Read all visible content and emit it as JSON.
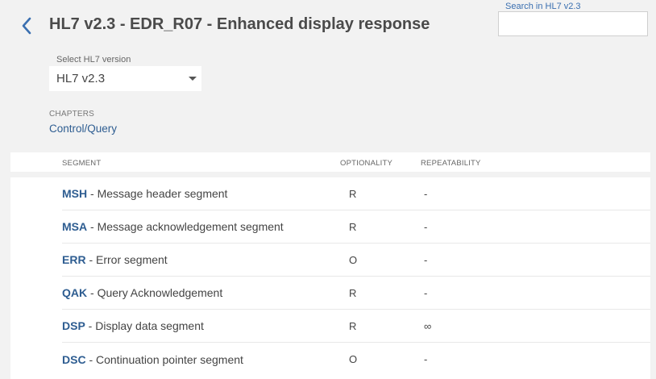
{
  "header": {
    "back_icon": "chevron-left-icon",
    "title": "HL7 v2.3 - EDR_R07 - Enhanced display response"
  },
  "search": {
    "label": "Search in HL7 v2.3",
    "value": ""
  },
  "version": {
    "label": "Select HL7 version",
    "selected": "HL7 v2.3"
  },
  "chapters": {
    "label": "CHAPTERS",
    "link": "Control/Query"
  },
  "table": {
    "columns": [
      "SEGMENT",
      "OPTIONALITY",
      "REPEATABILITY"
    ],
    "rows": [
      {
        "code": "MSH",
        "desc": " - Message header segment",
        "opt": "R",
        "rep": "-"
      },
      {
        "code": "MSA",
        "desc": " - Message acknowledgement segment",
        "opt": "R",
        "rep": "-"
      },
      {
        "code": "ERR",
        "desc": " - Error segment",
        "opt": "O",
        "rep": "-"
      },
      {
        "code": "QAK",
        "desc": " - Query Acknowledgement",
        "opt": "R",
        "rep": "-"
      },
      {
        "code": "DSP",
        "desc": " - Display data segment",
        "opt": "R",
        "rep": "∞"
      },
      {
        "code": "DSC",
        "desc": " - Continuation pointer segment",
        "opt": "O",
        "rep": "-"
      }
    ]
  },
  "colors": {
    "accent": "#3a6fb0",
    "link": "#2e5d91",
    "background": "#f2f2f2"
  }
}
